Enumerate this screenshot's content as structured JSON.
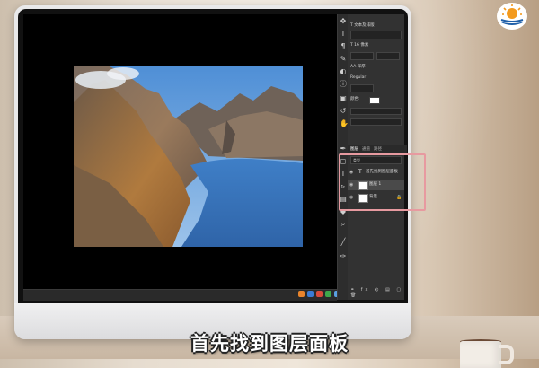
{
  "subtitle": "首先找到图层面板",
  "panel": {
    "character_rows": [
      "T 文本及排版",
      "T 16 像素",
      "AA 浑厚",
      "Regular",
      "颜色:"
    ],
    "tabs": [
      {
        "label": "图层",
        "active": true
      },
      {
        "label": "通道",
        "active": false
      },
      {
        "label": "路径",
        "active": false
      }
    ],
    "kind_filter": "类型",
    "layers": [
      {
        "name": "首先找到图层面板",
        "type": "text",
        "selected": false
      },
      {
        "name": "图层 1",
        "type": "pixel",
        "selected": true
      },
      {
        "name": "背景",
        "type": "background",
        "selected": false
      }
    ]
  },
  "highlight_color": "#e79aa0",
  "taskbar_icons": [
    "app-icon-orange",
    "app-icon-blue",
    "app-icon-red",
    "app-icon-green",
    "app-icon-blue-2",
    "app-icon-gray"
  ]
}
